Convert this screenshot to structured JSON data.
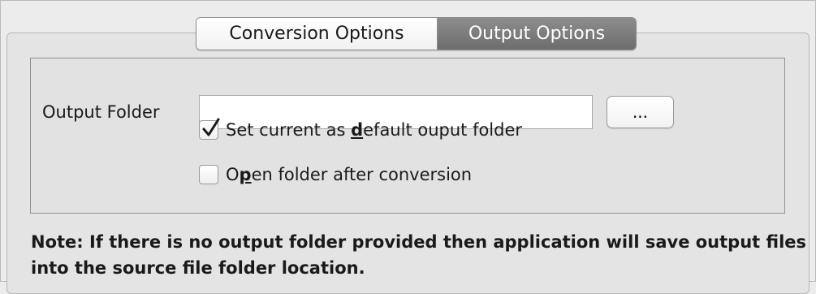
{
  "tabs": [
    {
      "label": "Conversion Options",
      "active": false
    },
    {
      "label": "Output Options",
      "active": true
    }
  ],
  "output_folder": {
    "label": "Output Folder",
    "value": "",
    "placeholder": "",
    "browse_label": "..."
  },
  "options": {
    "set_default": {
      "checked": true,
      "label_pre": "Set current as ",
      "label_mnemonic": "d",
      "label_post": "efault ouput folder"
    },
    "open_after": {
      "checked": false,
      "label_pre": "O",
      "label_mnemonic": "p",
      "label_post": "en folder after conversion"
    }
  },
  "note": "Note: If there is no output folder provided then application will save output files into the source file folder location.",
  "colors": {
    "active_tab_bg": "#7d7d7d",
    "inactive_tab_bg": "#f7f7f7",
    "panel_bg": "#e2e2e2"
  }
}
